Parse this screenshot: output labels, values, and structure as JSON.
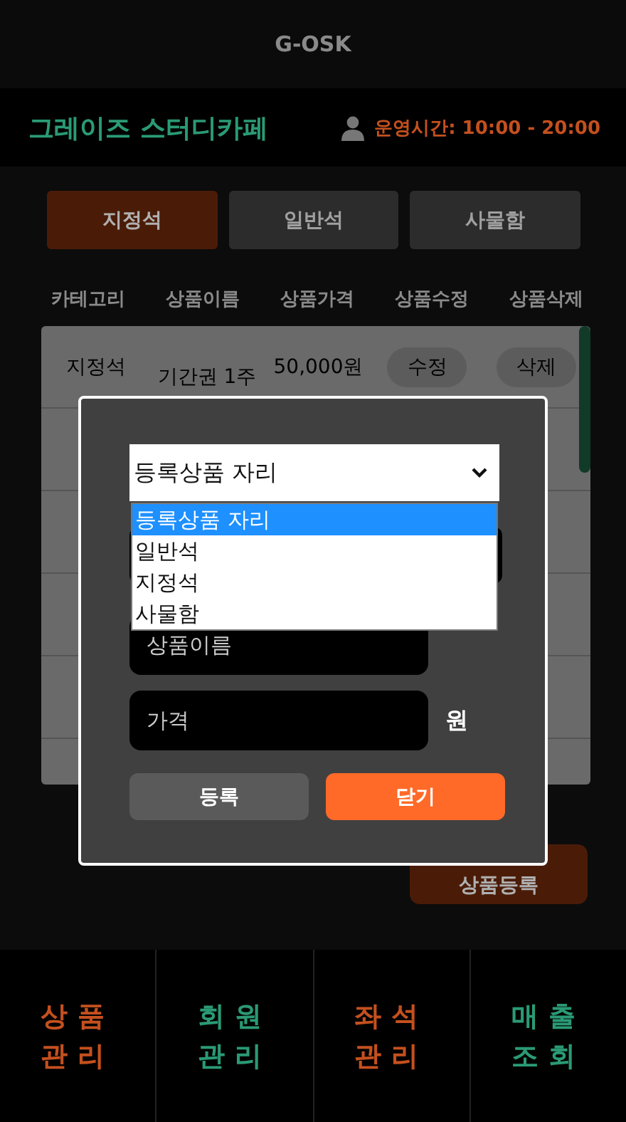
{
  "header": {
    "title": "G-OSK"
  },
  "shop": {
    "name": "그레이즈 스터디카페",
    "hours": "운영시간: 10:00 - 20:00"
  },
  "tabs": [
    {
      "label": "지정석",
      "selected": true
    },
    {
      "label": "일반석",
      "selected": false
    },
    {
      "label": "사물함",
      "selected": false
    }
  ],
  "table": {
    "columns": [
      "카테고리",
      "상품이름",
      "상품가격",
      "상품수정",
      "상품삭제"
    ],
    "rows": [
      {
        "category": "지정석",
        "name": "기간권 1주",
        "price": "50,000원",
        "edit": "수정",
        "delete": "삭제"
      }
    ]
  },
  "register_button": "상품등록",
  "modal": {
    "select": {
      "value": "등록상품 자리",
      "options": [
        {
          "label": "등록상품 자리",
          "selected": true
        },
        {
          "label": "일반석",
          "selected": false
        },
        {
          "label": "지정석",
          "selected": false
        },
        {
          "label": "사물함",
          "selected": false
        }
      ]
    },
    "fields": [
      {
        "placeholder": "상품이름"
      },
      {
        "placeholder": "가격",
        "unit": "원"
      }
    ],
    "buttons": [
      {
        "label": "등록",
        "kind": "secondary"
      },
      {
        "label": "닫기",
        "kind": "primary"
      }
    ]
  },
  "nav": [
    {
      "label": "상품\n관리",
      "color": "#c4501e"
    },
    {
      "label": "회원\n관리",
      "color": "#2a9a75"
    },
    {
      "label": "좌석\n관리",
      "color": "#c4501e"
    },
    {
      "label": "매출\n조회",
      "color": "#2a9a75"
    }
  ]
}
